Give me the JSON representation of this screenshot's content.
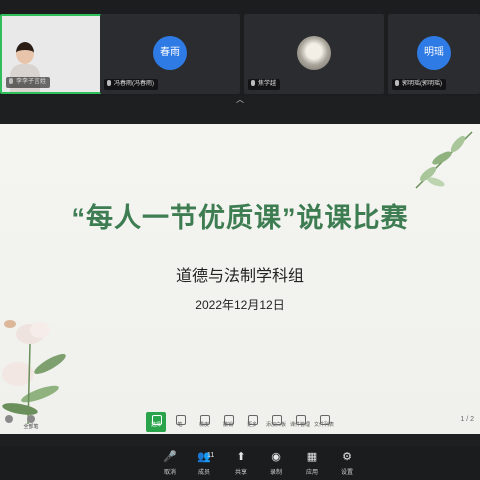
{
  "participants": [
    {
      "name": "李李子言姓",
      "avatar": "",
      "type": "video"
    },
    {
      "name": "冯春雨(冯春雨)",
      "avatar": "春雨",
      "type": "initials"
    },
    {
      "name": "焦学越",
      "avatar": "",
      "type": "photo"
    },
    {
      "name": "郭明瑶(郭明瑶)",
      "avatar": "明瑶",
      "type": "initials"
    }
  ],
  "slide": {
    "title": "“每人一节优质课”说课比赛",
    "subtitle": "道德与法制学科组",
    "date": "2022年12月12日"
  },
  "whiteboard_tools": [
    {
      "label": "选择",
      "active": true
    },
    {
      "label": "笔"
    },
    {
      "label": "橡皮"
    },
    {
      "label": "撤销"
    },
    {
      "label": "更多"
    },
    {
      "label": "添加白板"
    },
    {
      "label": "课件管理"
    },
    {
      "label": "文件列表"
    }
  ],
  "left_tools": [
    "",
    "全部笔"
  ],
  "page_nav": "1 / 2",
  "bottom_bar": {
    "mute": "取消",
    "members": "成员",
    "member_count": "11",
    "share": "共享",
    "record": "录制",
    "apps": "应用",
    "settings": "设置"
  },
  "colors": {
    "accent_green": "#2fbf5a",
    "title_green": "#3e7d52",
    "avatar_blue": "#2f7be5"
  }
}
